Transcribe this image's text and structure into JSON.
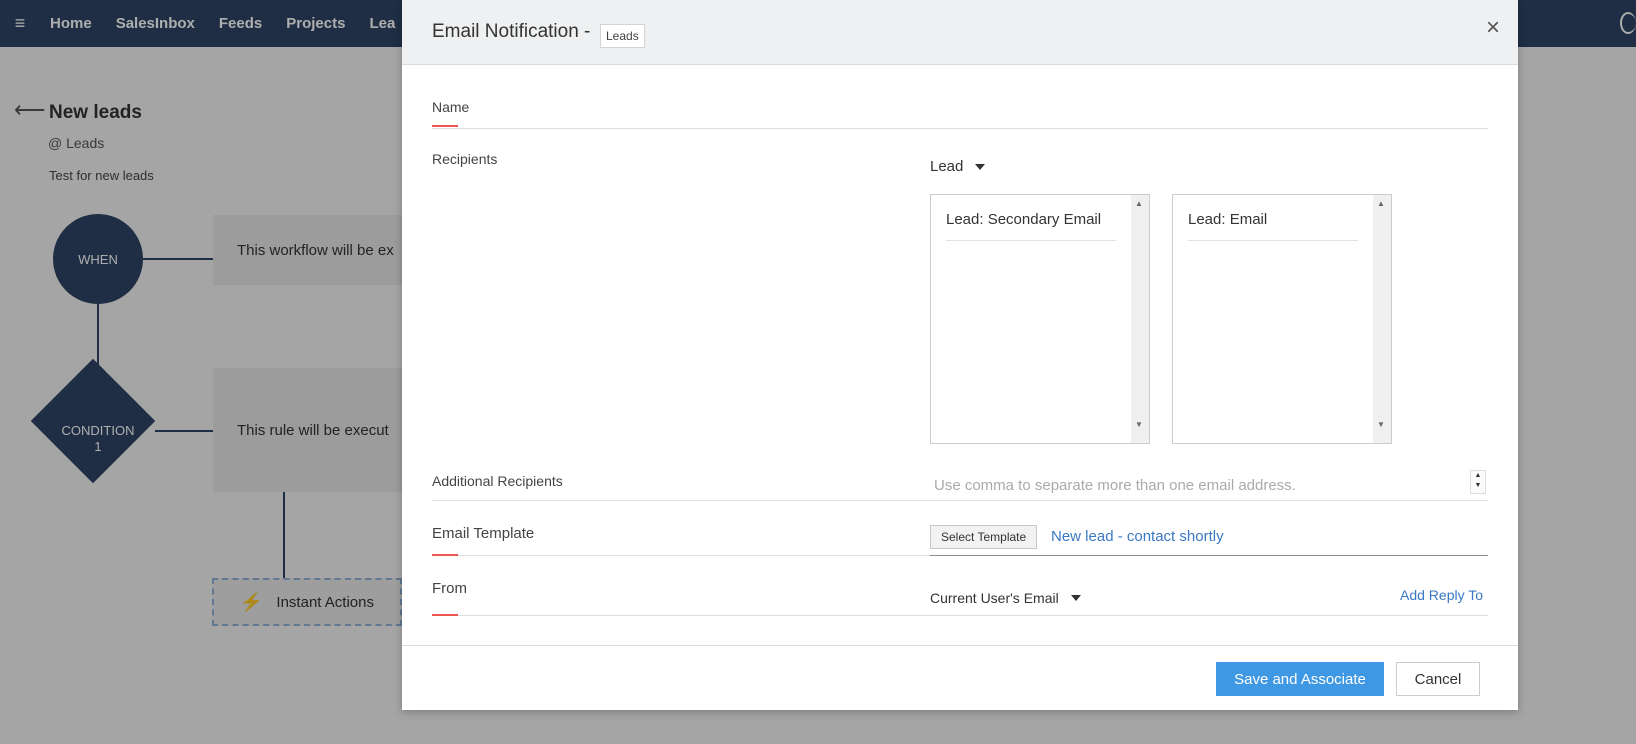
{
  "nav": {
    "items": [
      "Home",
      "SalesInbox",
      "Feeds",
      "Projects",
      "Lea"
    ]
  },
  "workflow": {
    "title": "New leads",
    "module": "@ Leads",
    "description": "Test for new leads",
    "when_label": "WHEN",
    "when_text": "This workflow will be ex",
    "condition_label": "CONDITION\n1",
    "condition_text": "This rule will be execut",
    "instant_actions": "Instant Actions"
  },
  "modal": {
    "title": "Email Notification -",
    "module_badge": "Leads",
    "close": "×",
    "fields": {
      "name_label": "Name",
      "recipients_label": "Recipients",
      "recipients_type": "Lead",
      "available_list": [
        "Lead: Secondary Email"
      ],
      "selected_list": [
        "Lead: Email"
      ],
      "additional_label": "Additional Recipients",
      "additional_placeholder": "Use comma to separate more than one email address.",
      "template_label": "Email Template",
      "select_template": "Select Template",
      "template_name": "New lead - contact shortly",
      "from_label": "From",
      "from_value": "Current User's Email",
      "add_reply_to": "Add Reply To"
    },
    "footer": {
      "save": "Save and Associate",
      "cancel": "Cancel"
    }
  },
  "colors": {
    "nav_bg": "#2f4565",
    "primary": "#3f98e3",
    "link": "#3a78c3",
    "required_mark": "#e55555"
  }
}
